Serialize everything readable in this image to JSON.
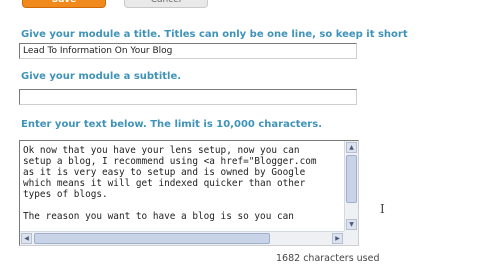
{
  "buttons": {
    "save_label": "Save",
    "cancel_label": "Cancel"
  },
  "form": {
    "title_label": "Give your module a title. Titles can only be one line, so keep it short",
    "title_value": "Lead To Information On Your Blog",
    "subtitle_label": "Give your module a subtitle.",
    "subtitle_value": "",
    "text_label": "Enter your text below. The limit is 10,000 characters.",
    "text_value": "Ok now that you have your lens setup, now you can\nsetup a blog, I recommend using <a href=\"Blogger.com\nas it is very easy to setup and is owned by Google\nwhich means it will get indexed quicker than other\ntypes of blogs.\n\nThe reason you want to have a blog is so you can",
    "char_count": "1682 characters used"
  },
  "colors": {
    "label": "#3f93b8",
    "save_button": "#f08a1c"
  }
}
